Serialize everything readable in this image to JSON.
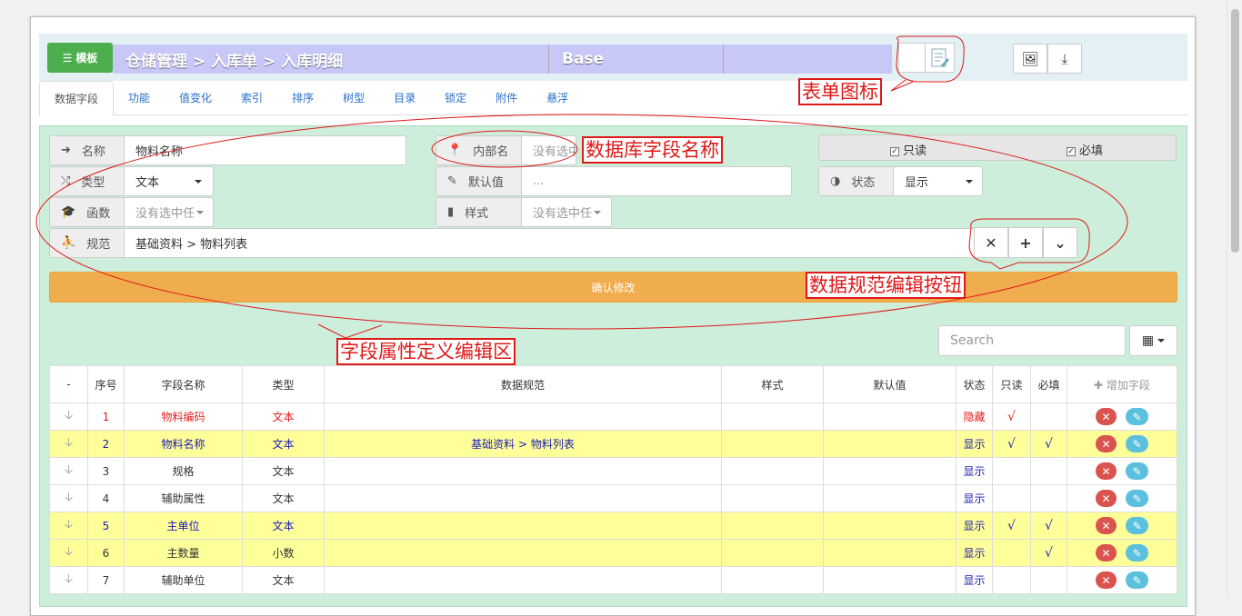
{
  "header": {
    "template_label": "模板",
    "breadcrumb": "仓储管理 > 入库单 > 入库明细",
    "base_label": "Base"
  },
  "tabs": [
    {
      "label": "数据字段"
    },
    {
      "label": "功能"
    },
    {
      "label": "值变化"
    },
    {
      "label": "索引"
    },
    {
      "label": "排序"
    },
    {
      "label": "树型"
    },
    {
      "label": "目录"
    },
    {
      "label": "锁定"
    },
    {
      "label": "附件"
    },
    {
      "label": "悬浮"
    }
  ],
  "form": {
    "name_label": "名称",
    "name_value": "物料名称",
    "type_label": "类型",
    "type_value": "文本",
    "func_label": "函数",
    "func_placeholder": "没有选中任",
    "norm_label": "规范",
    "norm_value": "基础资料 > 物料列表",
    "inner_label": "内部名",
    "inner_placeholder": "没有选中任",
    "default_label": "默认值",
    "default_value": "...",
    "style_label": "样式",
    "style_placeholder": "没有选中任",
    "readonly_label": "只读",
    "required_label": "必填",
    "state_label": "状态",
    "state_value": "显示",
    "confirm_label": "确认修改"
  },
  "search": {
    "placeholder": "Search"
  },
  "table": {
    "headers": [
      "-",
      "序号",
      "字段名称",
      "类型",
      "数据规范",
      "样式",
      "默认值",
      "状态",
      "只读",
      "必填",
      "增加字段"
    ],
    "rows": [
      {
        "no": "1",
        "name": "物料编码",
        "type": "文本",
        "norm": "",
        "state": "隐藏",
        "readonly": "√",
        "required": ""
      },
      {
        "no": "2",
        "name": "物料名称",
        "type": "文本",
        "norm": "基础资料 > 物料列表",
        "state": "显示",
        "readonly": "√",
        "required": "√"
      },
      {
        "no": "3",
        "name": "规格",
        "type": "文本",
        "norm": "",
        "state": "显示",
        "readonly": "",
        "required": ""
      },
      {
        "no": "4",
        "name": "辅助属性",
        "type": "文本",
        "norm": "",
        "state": "显示",
        "readonly": "",
        "required": ""
      },
      {
        "no": "5",
        "name": "主单位",
        "type": "文本",
        "norm": "",
        "state": "显示",
        "readonly": "√",
        "required": "√"
      },
      {
        "no": "6",
        "name": "主数量",
        "type": "小数",
        "norm": "",
        "state": "显示",
        "readonly": "",
        "required": "√"
      },
      {
        "no": "7",
        "name": "辅助单位",
        "type": "文本",
        "norm": "",
        "state": "显示",
        "readonly": "",
        "required": ""
      }
    ]
  },
  "annotations": {
    "form_icon": "表单图标",
    "db_field_name": "数据库字段名称",
    "norm_edit_buttons": "数据规范编辑按钮",
    "field_attr_area": "字段属性定义编辑区"
  },
  "colors": {
    "template_green": "#4cae4c",
    "confirm_orange": "#f0ad4e",
    "panel_green": "#cdeedb",
    "annotation_red": "#e01818"
  }
}
